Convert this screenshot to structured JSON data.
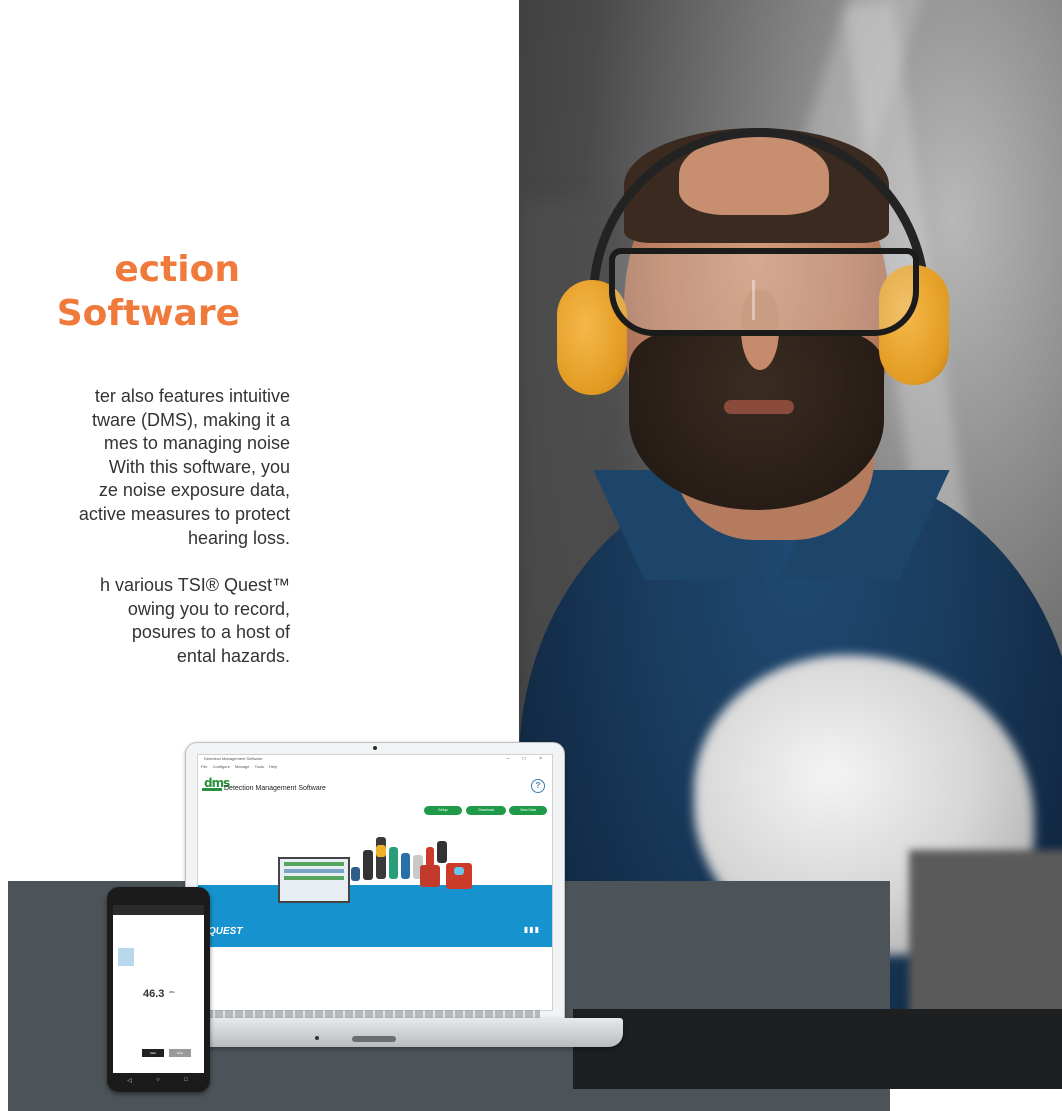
{
  "heading": {
    "line1": "ection",
    "line2": " Software"
  },
  "body": {
    "paragraph1": [
      "ter also features intuitive",
      "tware (DMS), making it a",
      "mes to managing noise",
      "With this software, you",
      "ze noise exposure data,",
      "active measures to protect",
      "hearing loss."
    ],
    "paragraph2": [
      "h various TSI® Quest™",
      "owing you to record,",
      "posures to a host of",
      "ental hazards."
    ]
  },
  "laptop_screen": {
    "window_title": "Detection Management Software",
    "menu": [
      "File",
      "Configure",
      "Manage",
      "Tools",
      "Help"
    ],
    "app_title": "Detection Management Software",
    "logo": "dms",
    "buttons": [
      "Setup",
      "Download",
      "View Data"
    ],
    "brand": "QUEST",
    "help_icon": "?"
  },
  "phone_screen": {
    "reading": "46.3",
    "unit": "dBA",
    "primary_button": "Start",
    "secondary_button": "Stop"
  },
  "colors": {
    "heading": "#f07a3c",
    "dark_block": "#4c5459",
    "black_block": "#1d1f21",
    "dms_green": "#1f9a49",
    "quest_blue": "#1693cf"
  }
}
